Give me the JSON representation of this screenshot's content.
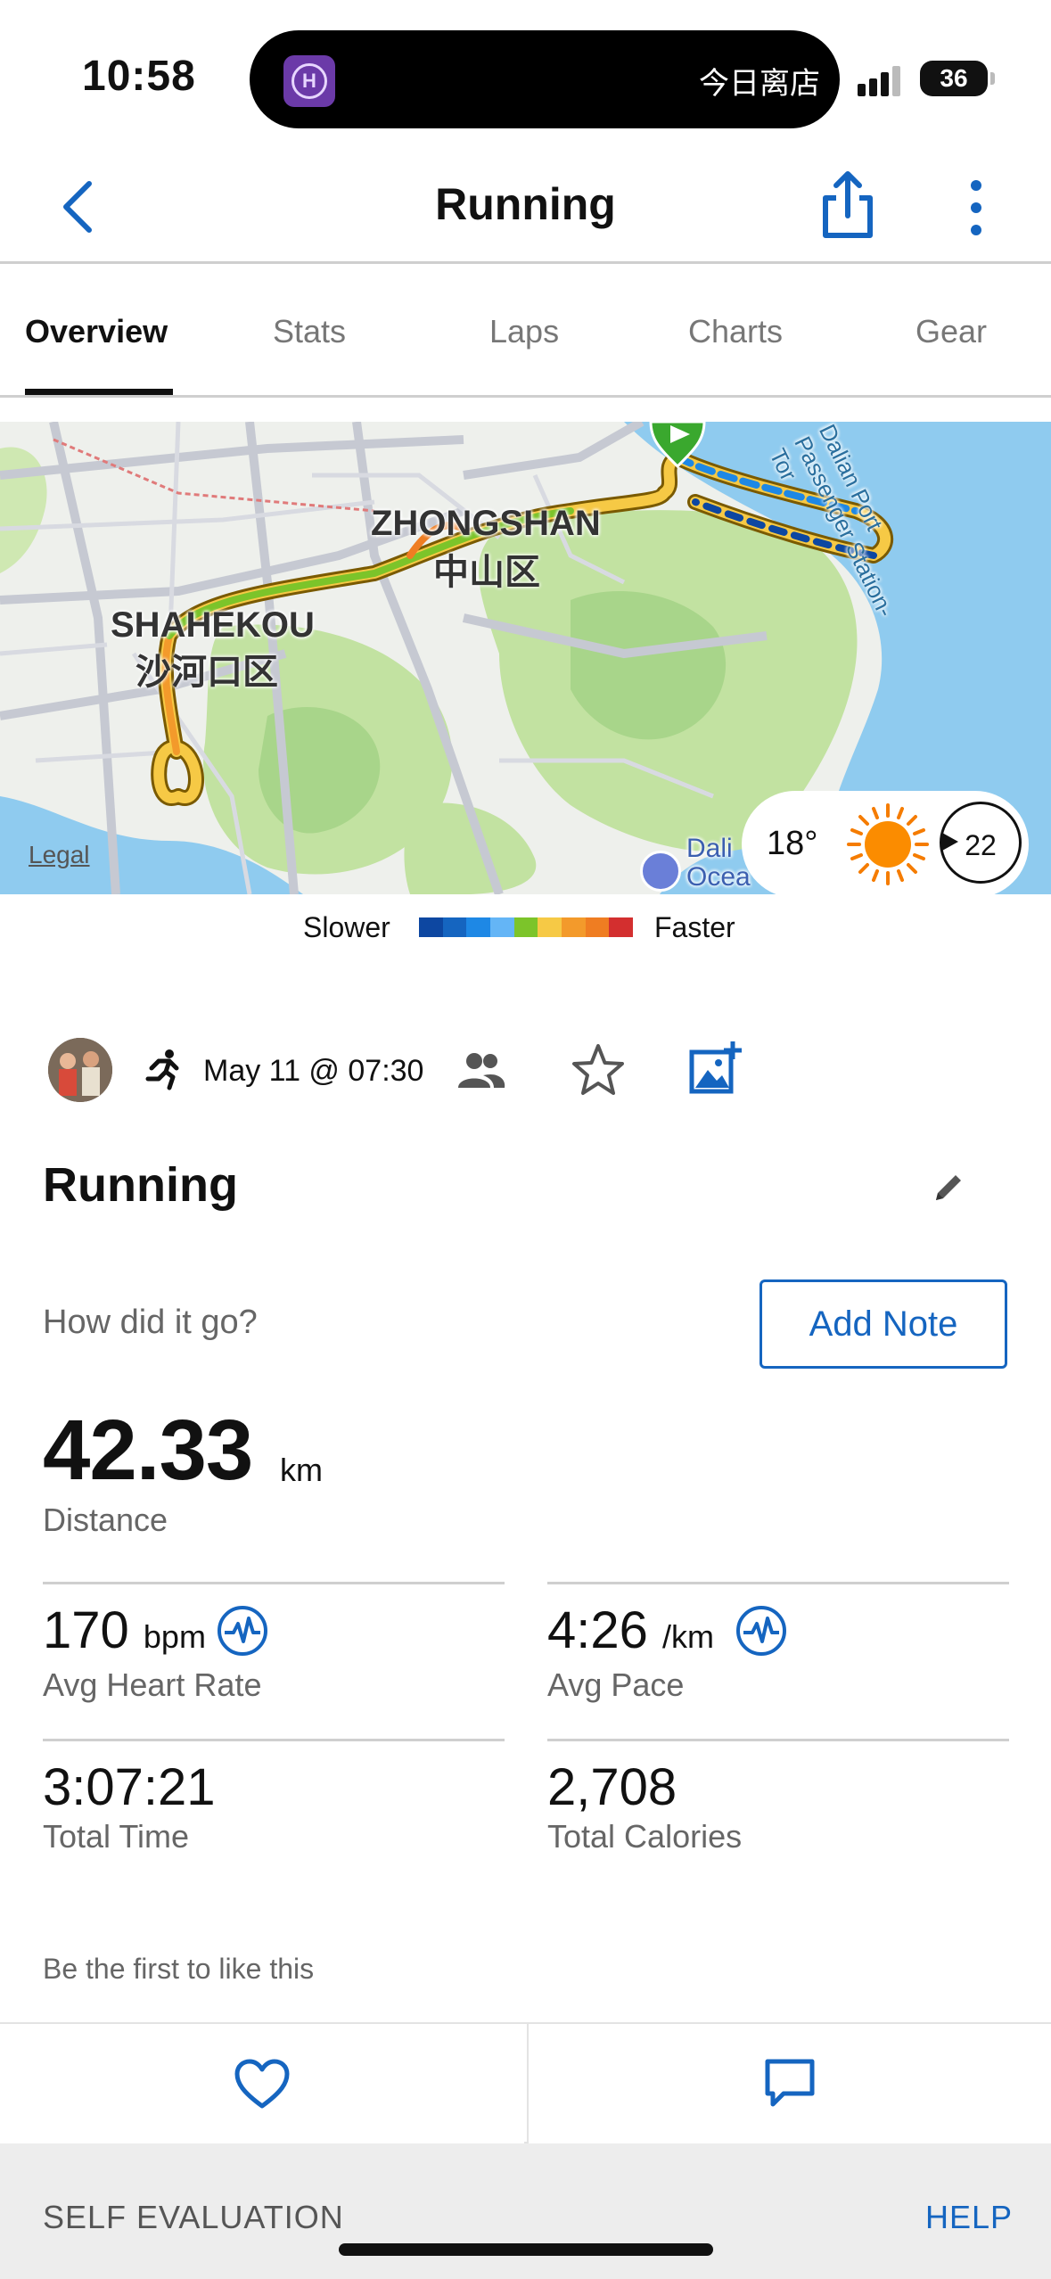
{
  "status_bar": {
    "time": "10:58",
    "island_text": "今日离店",
    "battery": "36"
  },
  "nav": {
    "title": "Running"
  },
  "tabs": [
    {
      "label": "Overview",
      "active": true
    },
    {
      "label": "Stats",
      "active": false
    },
    {
      "label": "Laps",
      "active": false
    },
    {
      "label": "Charts",
      "active": false
    },
    {
      "label": "Gear",
      "active": false
    }
  ],
  "map": {
    "labels": {
      "zhongshan_en": "ZHONGSHAN",
      "zhongshan_cn": "中山区",
      "shahekou_en": "SHAHEKOU",
      "shahekou_cn": "沙河口区",
      "port_station": "Dalian Port Passenger Station-Tor",
      "poi": "Dali",
      "poi2": "Ocea"
    },
    "legal": "Legal",
    "weather": {
      "temperature": "18°",
      "wind": "22",
      "icon": "sun-icon"
    }
  },
  "pace_legend": {
    "slower": "Slower",
    "faster": "Faster",
    "colors": [
      "#0d47a1",
      "#1565c0",
      "#1e88e5",
      "#64b5f6",
      "#7cc42a",
      "#f6c945",
      "#f39a2b",
      "#ef7d22",
      "#d32f2f"
    ]
  },
  "activity": {
    "date": "May 11 @ 07:30",
    "name": "Running",
    "note_prompt": "How did it go?",
    "add_note": "Add Note"
  },
  "distance": {
    "value": "42.33",
    "unit": "km",
    "label": "Distance"
  },
  "stats": {
    "heart_rate": {
      "value": "170",
      "unit": "bpm",
      "label": "Avg Heart Rate"
    },
    "pace": {
      "value": "4:26",
      "unit": "/km",
      "label": "Avg Pace"
    },
    "time": {
      "value": "3:07:21",
      "label": "Total Time"
    },
    "calories": {
      "value": "2,708",
      "label": "Total Calories"
    }
  },
  "social": {
    "likes_text": "Be the first to like this"
  },
  "footer": {
    "left": "SELF EVALUATION",
    "right": "HELP"
  },
  "colors": {
    "accent": "#1565c0",
    "route_green": "#7cc42a",
    "route_orange": "#f39a2b",
    "start_marker": "#3aa82e"
  }
}
